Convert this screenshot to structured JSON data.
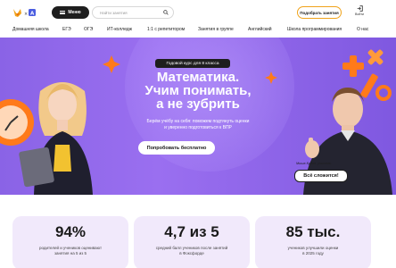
{
  "header": {
    "menu_label": "Меню",
    "search_placeholder": "Найти занятия",
    "cta_label": "Подобрать занятия",
    "login_label": "Войти"
  },
  "nav": {
    "items": [
      "Домашняя школа",
      "ЕГЭ",
      "ОГЭ",
      "ИТ-колледж",
      "1:1 с репетитором",
      "Занятия в группе",
      "Английский",
      "Школа программирования",
      "О нас"
    ]
  },
  "hero": {
    "badge": "Годовой курс для 8 класса",
    "title_line1": "Математика.",
    "title_line2": "Учим понимать,",
    "title_line3": "а не зубрить",
    "subtitle_line1": "Берём учёбу на себя: поможем подтянуть оценки",
    "subtitle_line2": "и уверенно подготовиться к ВПР",
    "cta_label": "Попробовать бесплатно",
    "teacher_caption": "Миша Кудин, учитель",
    "speech_text": "Всё сложится!"
  },
  "stats": [
    {
      "value": "94%",
      "desc_line1": "родителей и учеников оценивают",
      "desc_line2": "занятия на 5 из 5"
    },
    {
      "value": "4,7 из 5",
      "desc_line1": "средний балл учеников после занятий",
      "desc_line2": "в Фоксфорде"
    },
    {
      "value": "85 тыс.",
      "desc_line1": "учеников улучшили оценки",
      "desc_line2": "в 2025 году"
    }
  ],
  "colors": {
    "hero_bg": "#8a63e6",
    "accent": "#f0a31b",
    "dark": "#1e1e1e",
    "stat_bg": "#f1e9fb"
  }
}
